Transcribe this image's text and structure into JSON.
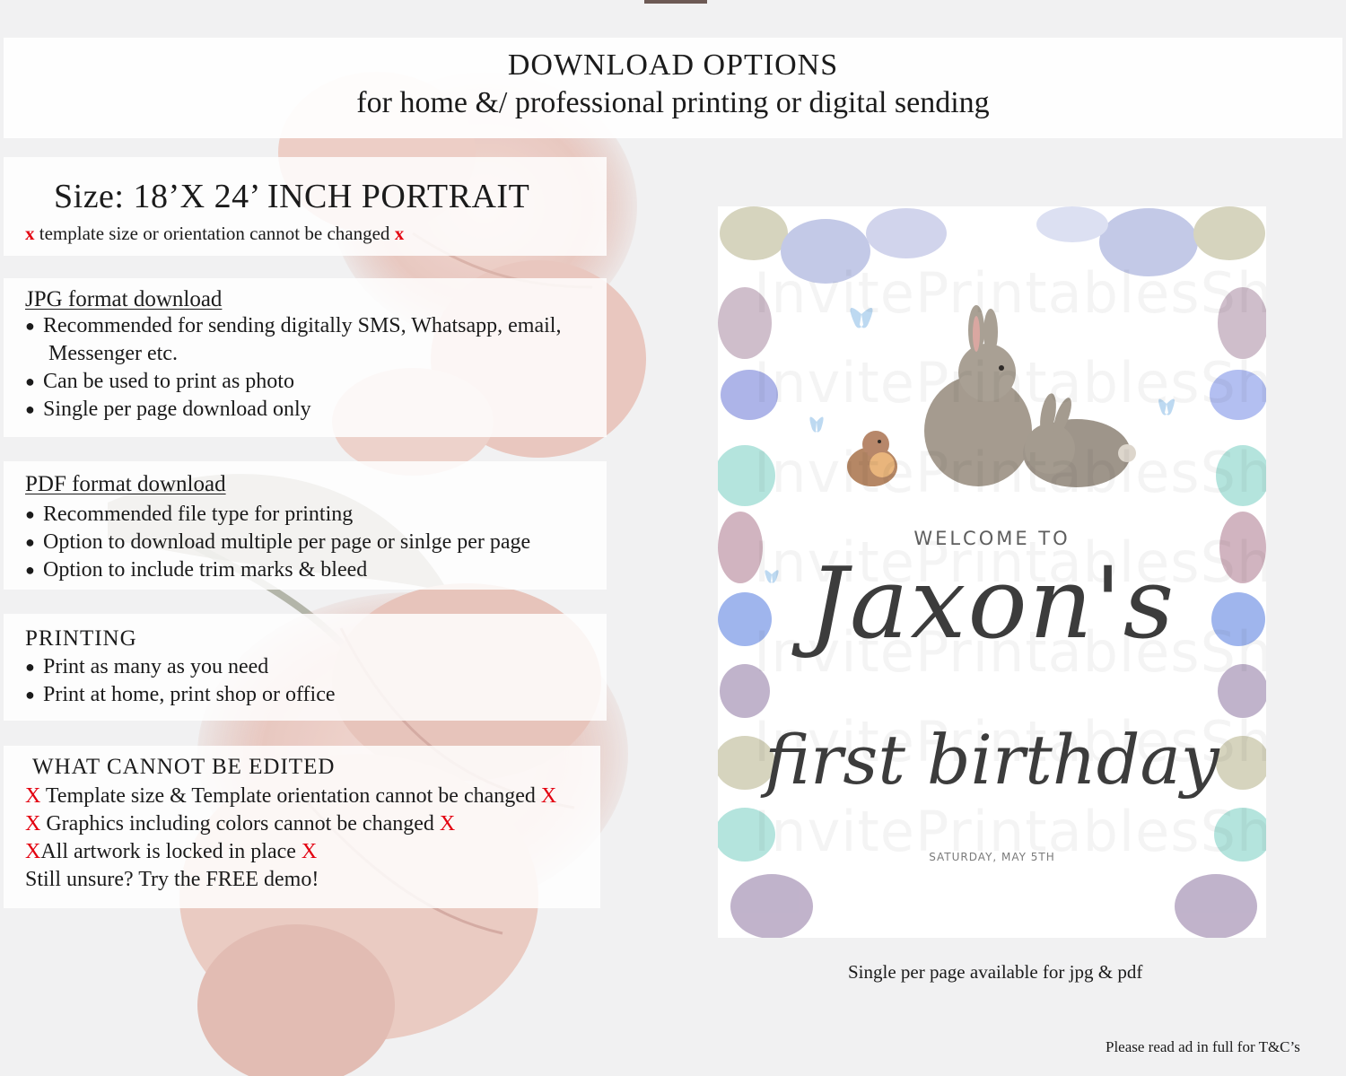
{
  "header": {
    "title": "DOWNLOAD OPTIONS",
    "subtitle": "for home &/ professional printing or digital sending"
  },
  "size_panel": {
    "title": "Size: 18’X 24’ INCH PORTRAIT",
    "note": "template size or orientation cannot be changed",
    "x_mark": "x"
  },
  "jpg_panel": {
    "title": "JPG format download",
    "items": [
      "Recommended for sending digitally SMS, Whatsapp, email,",
      "Messenger etc.",
      "Can be used to print as photo",
      "Single per page download only"
    ]
  },
  "pdf_panel": {
    "title": "PDF format download",
    "items": [
      "Recommended file type for printing",
      "Option to download multiple per page or sinlge per page",
      "Option to include trim marks & bleed"
    ]
  },
  "printing_panel": {
    "title": "PRINTING",
    "items": [
      "Print as many as you need",
      "Print at home, print shop or office"
    ]
  },
  "cannot_panel": {
    "title": "WHAT CANNOT BE EDITED",
    "x_mark": "X",
    "items": [
      "Template size & Template orientation cannot be changed",
      "Graphics including colors cannot be changed",
      "All artwork is locked in place"
    ],
    "demo": "Still unsure? Try the FREE demo!"
  },
  "bullet": "●",
  "poster": {
    "welcome": "WELCOME TO",
    "name": "Jaxon's",
    "subtitle": "first birthday",
    "date": "SATURDAY, MAY 5TH",
    "watermark": "InvitePrintablesShop"
  },
  "caption": "Single per page available for jpg & pdf",
  "footer_note": "Please read ad in full for T&C’s",
  "colors": {
    "x_mark": "#e3000f",
    "background": "#f1f1f2",
    "flower": "#e9c9c2",
    "text": "#1b1b1b"
  }
}
